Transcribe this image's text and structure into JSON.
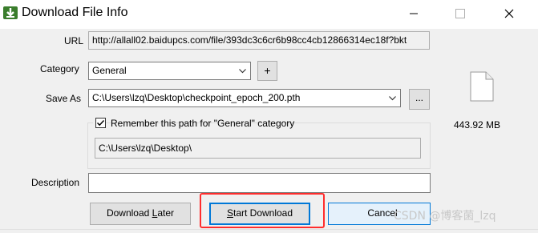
{
  "window": {
    "title": "Download File Info",
    "app_icon": "idm-arrow-icon",
    "controls": [
      "minimize-icon",
      "maximize-icon",
      "close-icon"
    ]
  },
  "url": {
    "label": "URL",
    "value": "http://allall02.baidupcs.com/file/393dc3c6cr6b98cc4cb12866314ec18f?bkt"
  },
  "category": {
    "label": "Category",
    "value": "General",
    "add_label": "+"
  },
  "save_as": {
    "label": "Save As",
    "value": "C:\\Users\\lzq\\Desktop\\checkpoint_epoch_200.pth",
    "browse_label": "..."
  },
  "remember": {
    "checked": true,
    "label": "Remember this path for \"General\" category",
    "path": "C:\\Users\\lzq\\Desktop\\"
  },
  "file_info": {
    "icon": "file-icon",
    "size": "443.92  MB"
  },
  "description": {
    "label": "Description",
    "value": ""
  },
  "buttons": {
    "download_later_pre": "Download ",
    "download_later_u": "L",
    "download_later_post": "ater",
    "start_download_u": "S",
    "start_download_post": "tart Download",
    "cancel_pre": "Cancel",
    "cancel_post": ""
  },
  "watermark": "CSDN @博客菌_lzq",
  "highlight_color": "#ff2d2d"
}
